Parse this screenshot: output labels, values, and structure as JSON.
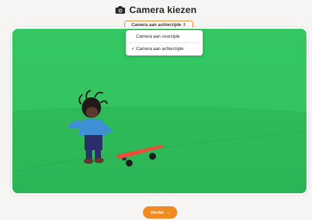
{
  "header": {
    "title": "Camera kiezen",
    "icon": "camera-icon"
  },
  "camera_select": {
    "selected_label": "Camera aan achterzijde",
    "chevron": "⇕",
    "options": [
      {
        "label": "Camera aan voorzijde",
        "checked": false
      },
      {
        "label": "Camera aan achterzijde",
        "checked": true
      }
    ],
    "check_glyph": "✓"
  },
  "footer": {
    "next_label": "Verder →"
  },
  "colors": {
    "accent": "#f08a23",
    "greenscreen": "#35c763"
  }
}
